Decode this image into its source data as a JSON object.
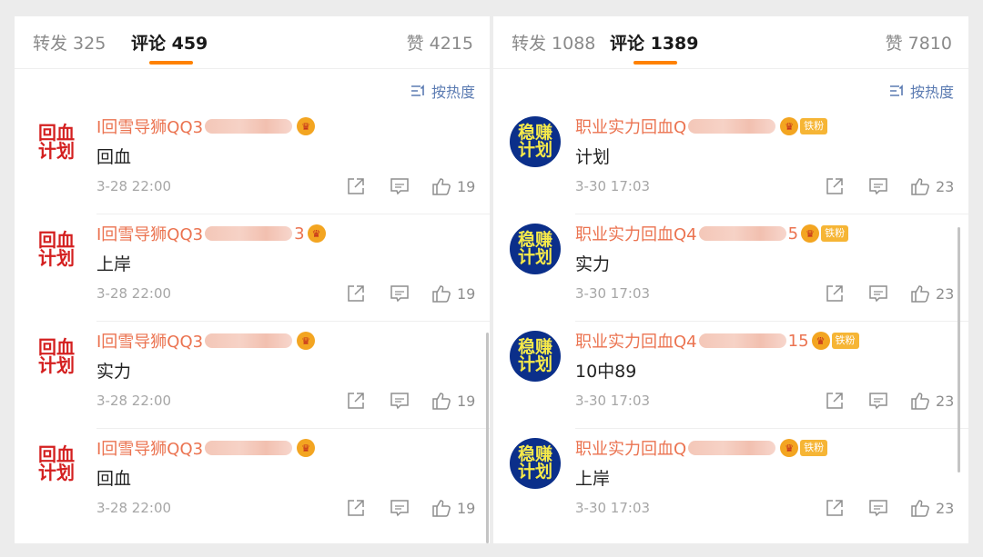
{
  "left": {
    "tabs": {
      "repost": "转发 325",
      "comments": "评论 459",
      "likes": "赞 4215"
    },
    "sort_label": "按热度",
    "comments": [
      {
        "avatar_line1": "回血",
        "avatar_line2": "计划",
        "name_prefix": "I回雪导狮QQ3",
        "name_suffix": "",
        "text": "回血",
        "time": "3-28 22:00",
        "likes": "19"
      },
      {
        "avatar_line1": "回血",
        "avatar_line2": "计划",
        "name_prefix": "I回雪导狮QQ3",
        "name_suffix": "3",
        "text": "上岸",
        "time": "3-28 22:00",
        "likes": "19"
      },
      {
        "avatar_line1": "回血",
        "avatar_line2": "计划",
        "name_prefix": "I回雪导狮QQ3",
        "name_suffix": "",
        "text": "实力",
        "time": "3-28 22:00",
        "likes": "19"
      },
      {
        "avatar_line1": "回血",
        "avatar_line2": "计划",
        "name_prefix": "I回雪导狮QQ3",
        "name_suffix": "",
        "text": "回血",
        "time": "3-28 22:00",
        "likes": "19"
      }
    ]
  },
  "right": {
    "tabs": {
      "repost": "转发 1088",
      "comments": "评论 1389",
      "likes": "赞 7810"
    },
    "sort_label": "按热度",
    "badge_label": "铁粉",
    "comments": [
      {
        "avatar_line1": "稳赚",
        "avatar_line2": "计划",
        "name_prefix": "职业实力回血Q",
        "name_suffix": "",
        "text": "计划",
        "time": "3-30 17:03",
        "likes": "23"
      },
      {
        "avatar_line1": "稳赚",
        "avatar_line2": "计划",
        "name_prefix": "职业实力回血Q4",
        "name_suffix": "5",
        "text": "实力",
        "time": "3-30 17:03",
        "likes": "23"
      },
      {
        "avatar_line1": "稳赚",
        "avatar_line2": "计划",
        "name_prefix": "职业实力回血Q4",
        "name_suffix": "15",
        "text": "10中89",
        "time": "3-30 17:03",
        "likes": "23"
      },
      {
        "avatar_line1": "稳赚",
        "avatar_line2": "计划",
        "name_prefix": "职业实力回血Q",
        "name_suffix": "",
        "text": "上岸",
        "time": "3-30 17:03",
        "likes": "23"
      }
    ]
  },
  "icons": {
    "share": "share-icon",
    "reply": "reply-icon",
    "like": "thumbs-up-icon",
    "sort": "sort-icon",
    "vip": "crown-icon"
  },
  "colors": {
    "accent": "#ff8200",
    "username": "#eb7350",
    "link": "#5b7bb2"
  }
}
